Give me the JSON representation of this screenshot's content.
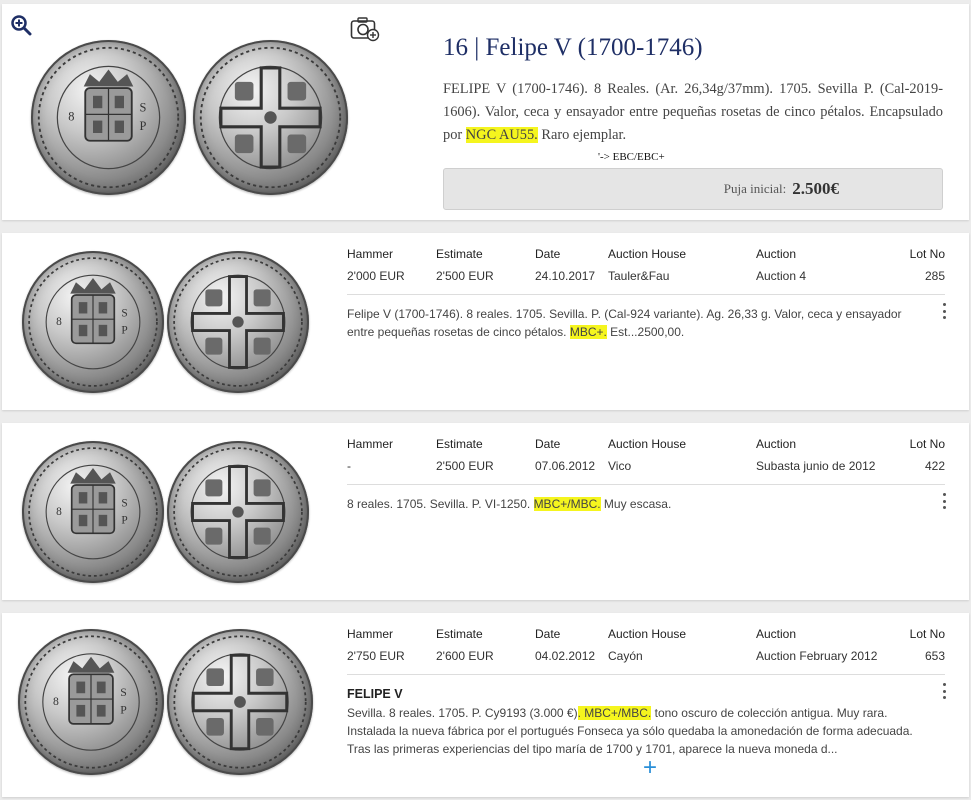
{
  "main_lot": {
    "title": "16 | Felipe V (1700-1746)",
    "description_parts": [
      "FELIPE V (1700-1746). 8 Reales. (Ar. 26,34g/37mm). 1705. Sevilla P. (Cal-2019-1606). Valor, ceca y ensayador entre pequeñas rosetas de cinco pétalos. Encapsulado por ",
      "NGC AU55.",
      " Raro ejemplar."
    ],
    "grade_note": "'-> EBC/EBC+",
    "bid_label": "Puja inicial:",
    "bid_value": "2.500€",
    "icons": [
      "zoom-in-icon",
      "camera-icon"
    ]
  },
  "table_headers": {
    "hammer": "Hammer",
    "estimate": "Estimate",
    "date": "Date",
    "auction_house": "Auction House",
    "auction": "Auction",
    "lot_no": "Lot No"
  },
  "results": [
    {
      "hammer": "2'000 EUR",
      "estimate": "2'500 EUR",
      "date": "24.10.2017",
      "auction_house": "Tauler&Fau",
      "auction": "Auction 4",
      "lot_no": "285",
      "title": "",
      "desc_before": "Felipe V (1700-1746). 8 reales. 1705. Sevilla. P. (Cal-924 variante). Ag. 26,33 g. Valor, ceca y ensayador entre pequeñas rosetas de cinco pétalos. ",
      "desc_highlight": "MBC+.",
      "desc_after": " Est...2500,00."
    },
    {
      "hammer": "-",
      "estimate": "2'500 EUR",
      "date": "07.06.2012",
      "auction_house": "Vico",
      "auction": "Subasta junio de 2012",
      "lot_no": "422",
      "title": "",
      "desc_before": "8 reales. 1705. Sevilla. P. VI-1250. ",
      "desc_highlight": "MBC+/MBC.",
      "desc_after": " Muy escasa."
    },
    {
      "hammer": "2'750 EUR",
      "estimate": "2'600 EUR",
      "date": "04.02.2012",
      "auction_house": "Cayón",
      "auction": "Auction February 2012",
      "lot_no": "653",
      "title": "FELIPE V",
      "desc_before": "Sevilla. 8 reales. 1705. P. Cy9193 (3.000 €)",
      "desc_highlight": ". MBC+/MBC.",
      "desc_after": " tono oscuro de colección antigua. Muy rara. Instalada la nueva fábrica por el portugués Fonseca ya sólo quedaba la amonedación de forma adecuada. Tras las primeras experiencias del tipo maría de 1700 y 1701, aparece la nueva moneda d..."
    }
  ],
  "colors": {
    "title_navy": "#1f2f66",
    "highlight_yellow": "#f5f51e",
    "expand_blue": "#2a8fd8"
  }
}
